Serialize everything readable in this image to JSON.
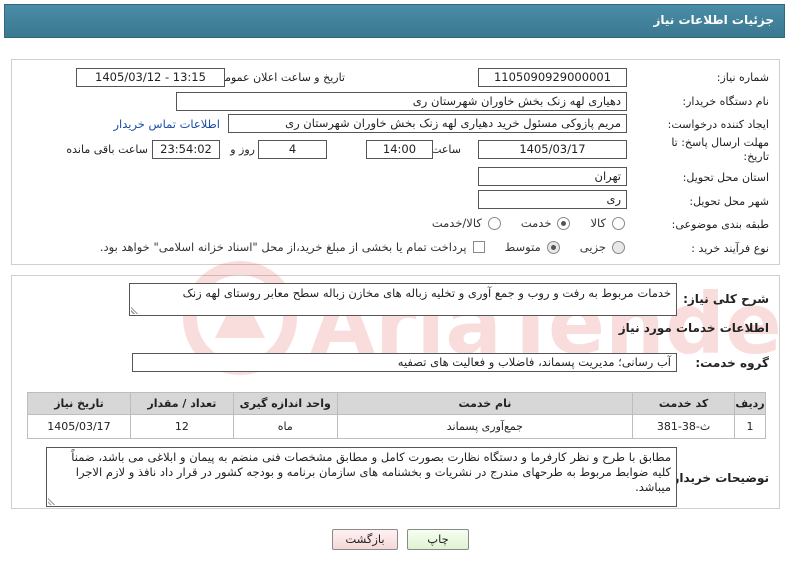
{
  "header": {
    "title": "جزئیات اطلاعات نیاز"
  },
  "fields": {
    "need_number_label": "شماره نیاز:",
    "need_number": "1105090929000001",
    "announce_label": "تاریخ و ساعت اعلان عمومی:",
    "announce_value": "1405/03/12 - 13:15",
    "buyer_org_label": "نام دستگاه خریدار:",
    "buyer_org": "دهیاری لهه زنک بخش خاوران شهرستان ری",
    "creator_label": "ایجاد کننده درخواست:",
    "creator": "مریم پازوکی مسئول خرید دهیاری لهه زنک بخش خاوران شهرستان ری",
    "contact_link": "اطلاعات تماس خریدار",
    "deadline_label": "مهلت ارسال پاسخ: تا تاریخ:",
    "deadline_date": "1405/03/17",
    "time_label": "ساعت",
    "deadline_time": "14:00",
    "days_value": "4",
    "days_label": "روز و",
    "remaining_time": "23:54:02",
    "remaining_label": "ساعت باقی مانده",
    "province_label": "استان محل تحویل:",
    "province": "تهران",
    "city_label": "شهر محل تحویل:",
    "city": "ری",
    "category_label": "طبقه بندی موضوعی:",
    "category_options": [
      "کالا",
      "خدمت",
      "کالا/خدمت"
    ],
    "process_label": "نوع فرآیند خرید :",
    "process_options": [
      "جزیی",
      "متوسط"
    ],
    "payment_note": "پرداخت تمام یا بخشی از مبلغ خرید،از محل \"اسناد خزانه اسلامی\" خواهد بود."
  },
  "summary": {
    "label": "شرح کلی نیاز:",
    "text": "خدمات مربوط به رفت و روب و جمع آوری و تخلیه زباله های مخازن زباله سطح معابر روستای لهه زنک"
  },
  "services": {
    "section_title": "اطلاعات خدمات مورد نیاز",
    "group_label": "گروه خدمت:",
    "group_value": "آب رسانی؛ مدیریت پسماند، فاضلاب و فعالیت های تصفیه",
    "columns": [
      "ردیف",
      "کد خدمت",
      "نام خدمت",
      "واحد اندازه گیری",
      "تعداد / مقدار",
      "تاریخ نیاز"
    ],
    "rows": [
      [
        "1",
        "ث-38-381",
        "جمع‌آوری پسماند",
        "ماه",
        "12",
        "1405/03/17"
      ]
    ]
  },
  "buyer_notes": {
    "label": "توضیحات خریدار:",
    "text": "مطابق با طرح و نظر کارفرما و دستگاه نظارت بصورت کامل و مطابق مشخصات فنی منضم به پیمان و ابلاغی می باشد، ضمناً کلیه ضوابط مربوط به طرحهای مندرج در نشریات و بخشنامه های سازمان برنامه و بودجه کشور در قرار داد نافذ و لازم الاجرا میباشد."
  },
  "buttons": {
    "print": "چاپ",
    "back": "بازگشت"
  },
  "colors": {
    "header_bg": "#3f8199",
    "link": "#1b4fa6",
    "table_header": "#d7d7d7"
  }
}
